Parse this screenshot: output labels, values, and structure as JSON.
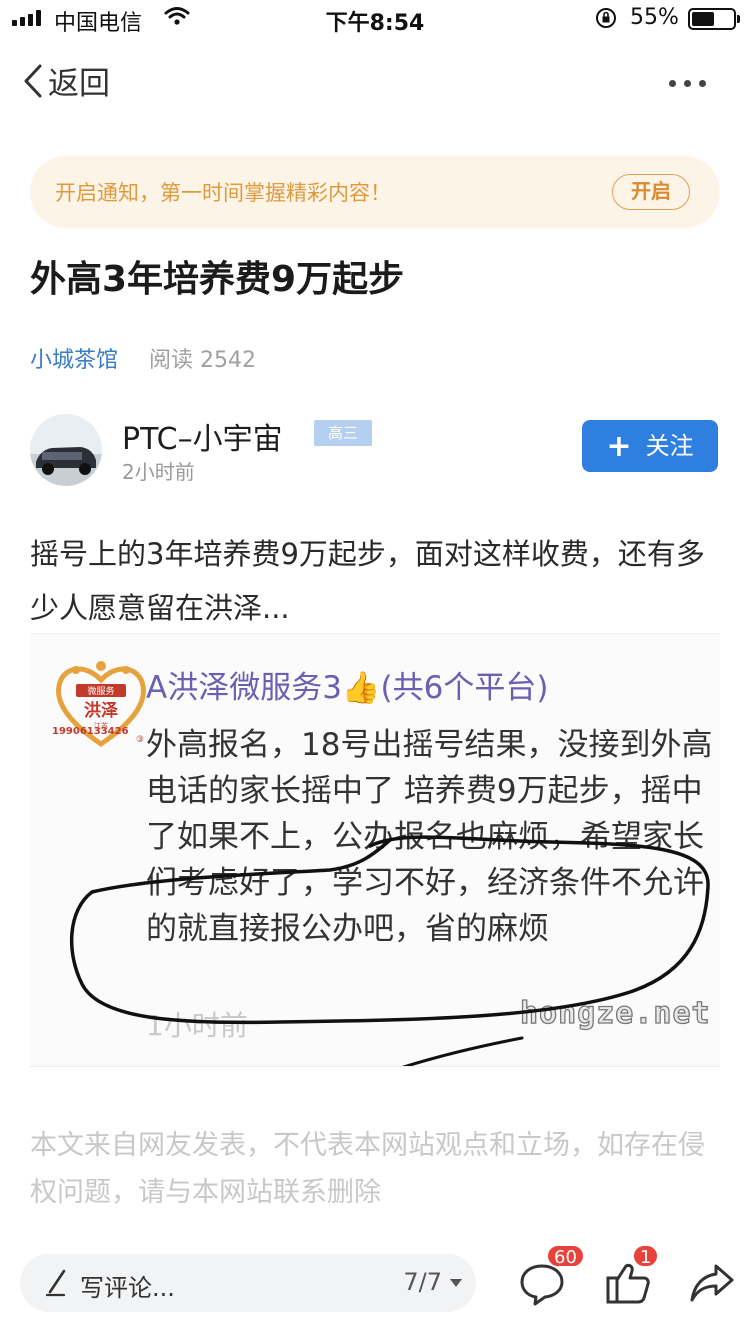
{
  "status_bar": {
    "carrier": "中国电信",
    "time": "下午8:54",
    "battery_text": "55%",
    "battery_level": 0.55
  },
  "nav": {
    "back_label": "返回",
    "more_icon": "more-dots-icon"
  },
  "notify_banner": {
    "text": "开启通知，第一时间掌握精彩内容！",
    "button_label": "开启"
  },
  "article": {
    "title": "外高3年培养费9万起步",
    "source": "小城茶馆",
    "reads": "阅读 2542",
    "author": {
      "name": "PTC–小宇宙",
      "grade_badge": "高三",
      "time_ago": "2小时前",
      "follow_label": "关注"
    },
    "summary": "摇号上的3年培养费9万起步，面对这样收费，还有多少人愿意留在洪泽...",
    "embedded_image": {
      "logo_top": "微服务",
      "logo_main": "洪泽",
      "logo_sub": "江苏",
      "logo_phone": "19906133426",
      "logo_mark": "③",
      "header": "A洪泽微服务3👍(共6个平台)",
      "body": "外高报名，18号出摇号结果，没接到外高电话的家长摇中了 培养费9万起步，摇中了如果不上，公办报名也麻烦，希望家长们考虑好了，学习不好，经济条件不允许的就直接报公办吧，省的麻烦",
      "time_ago": "1小时前",
      "watermark": "hongze.net"
    },
    "disclaimer": "本文来自网友发表，不代表本网站观点和立场，如存在侵权问题，请与本网站联系删除"
  },
  "bottom_bar": {
    "comment_placeholder": "写评论...",
    "page_indicator": "7/7",
    "comment_count": "60",
    "like_count": "1",
    "icons": [
      "pen-icon",
      "comment-icon",
      "like-icon",
      "share-icon"
    ]
  },
  "colors": {
    "accent_blue": "#2f7fe0",
    "link_blue": "#3a7cc5",
    "banner_bg": "#fdf4e8",
    "banner_text": "#e09a3e",
    "badge_red": "#e8423a"
  }
}
